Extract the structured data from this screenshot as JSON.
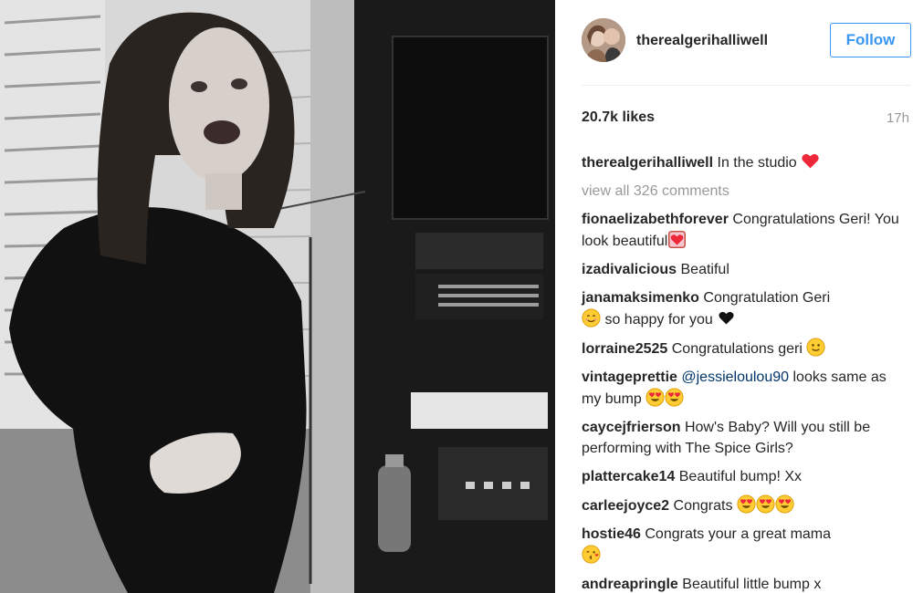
{
  "post": {
    "username": "therealgerihalliwell",
    "follow_label": "Follow",
    "likes": "20.7k likes",
    "time": "17h"
  },
  "caption": {
    "user": "therealgerihalliwell",
    "text": "In the studio",
    "emoji": "red-heart-icon"
  },
  "view_all": "view all 326 comments",
  "comments": [
    {
      "user": "fionaelizabethforever",
      "text": "Congratulations Geri! You look beautiful",
      "emoji": [
        "heart-gift-icon"
      ]
    },
    {
      "user": "izadivalicious",
      "text": "Beatiful",
      "emoji": []
    },
    {
      "user": "janamaksimenko",
      "text": "Congratulation Geri",
      "text2": "so happy for you",
      "emoji": [
        "smiling-face-icon",
        "black-heart-icon"
      ]
    },
    {
      "user": "lorraine2525",
      "text": "Congratulations geri",
      "emoji": [
        "slight-smile-icon"
      ]
    },
    {
      "user": "vintageprettie",
      "mention": "@jessieloulou90",
      "text": "looks same as my bump",
      "emoji": [
        "heart-eyes-icon",
        "heart-eyes-icon"
      ]
    },
    {
      "user": "caycejfrierson",
      "text": "How's Baby? Will you still be performing with The Spice Girls?",
      "emoji": []
    },
    {
      "user": "plattercake14",
      "text": "Beautiful bump! Xx",
      "emoji": []
    },
    {
      "user": "carleejoyce2",
      "text": "Congrats",
      "emoji": [
        "heart-eyes-icon",
        "heart-eyes-icon",
        "heart-eyes-icon"
      ]
    },
    {
      "user": "hostie46",
      "text": "Congrats your a great mama",
      "emoji": [
        "kissing-face-icon"
      ]
    },
    {
      "user": "andreapringle",
      "text": "Beautiful little bump x",
      "emoji": []
    }
  ],
  "colors": {
    "follow_blue": "#3897f0",
    "muted_gray": "#999999",
    "heart_red": "#ed2939",
    "emoji_yellow": "#ffcc33"
  }
}
